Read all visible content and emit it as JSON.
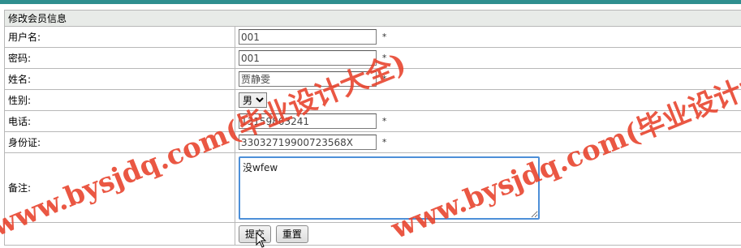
{
  "form": {
    "title": "修改会员信息",
    "fields": {
      "username": {
        "label": "用户名:",
        "value": "001",
        "required": "*"
      },
      "password": {
        "label": "密码:",
        "value": "001",
        "required": "*"
      },
      "name": {
        "label": "姓名:",
        "value": "贾静雯",
        "required": "*"
      },
      "gender": {
        "label": "性别:",
        "selected": "男"
      },
      "phone": {
        "label": "电话:",
        "value": "13159863241",
        "required": "*"
      },
      "idcard": {
        "label": "身份证:",
        "value": "33032719900723568X",
        "required": "*"
      },
      "remark": {
        "label": "备注:",
        "value": "没wfew"
      }
    },
    "buttons": {
      "submit": "提交",
      "reset": "重置"
    }
  },
  "watermark": {
    "line1": "www.bysjdq.com(毕业设计大全)",
    "line2": "www.bysjdq.com(毕业设计大"
  },
  "colors": {
    "accent": "#2f8f8f",
    "watermark": "#e8402a",
    "focus_border": "#4d8fd8"
  },
  "icons": {
    "cursor": "arrow-pointer-icon",
    "select_arrow": "triangle-down-icon"
  }
}
